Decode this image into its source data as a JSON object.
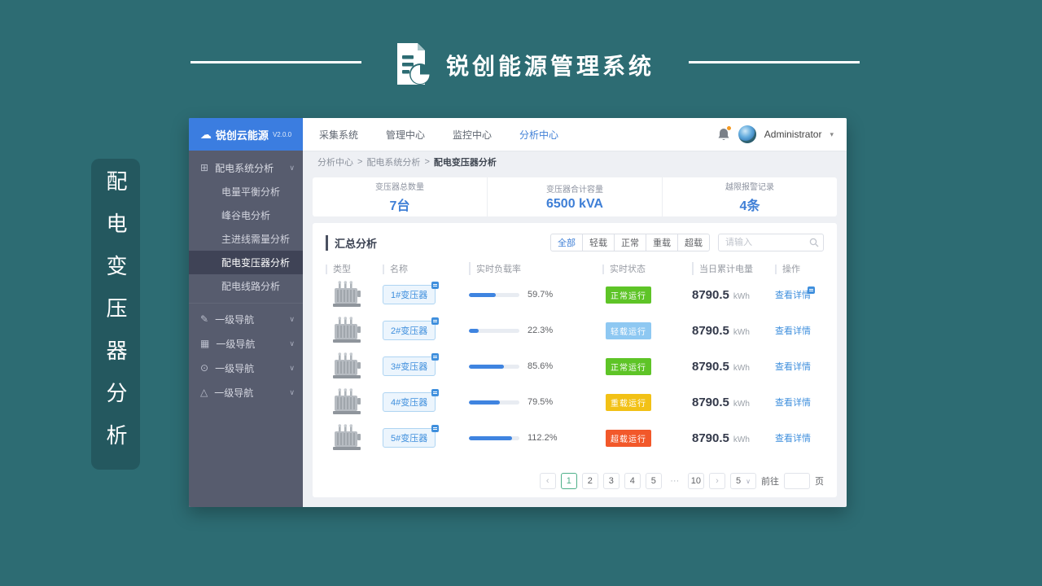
{
  "brand": {
    "title": "锐创能源管理系统"
  },
  "side_card": {
    "text": "配电变压器分析"
  },
  "icons": {
    "cloud": "☁",
    "chevron_down": "∨",
    "caret_down": "▾",
    "prev": "‹",
    "next": "›"
  },
  "colors": {
    "accent_blue": "#3f7fd6",
    "brand_teal": "#2d6c73"
  },
  "app": {
    "sidebar": {
      "logo_name": "锐创云能源",
      "logo_version": "V2.0.0",
      "group": {
        "icon": "⊞",
        "label": "配电系统分析"
      },
      "children": [
        {
          "label": "电量平衡分析"
        },
        {
          "label": "峰谷电分析"
        },
        {
          "label": "主进线需量分析"
        },
        {
          "label": "配电变压器分析"
        },
        {
          "label": "配电线路分析"
        }
      ],
      "collapsed": [
        {
          "icon": "✎",
          "label": "一级导航"
        },
        {
          "icon": "▦",
          "label": "一级导航"
        },
        {
          "icon": "⊙",
          "label": "一级导航"
        },
        {
          "icon": "△",
          "label": "一级导航"
        }
      ]
    },
    "topbar": {
      "nav": [
        {
          "label": "采集系统"
        },
        {
          "label": "管理中心"
        },
        {
          "label": "监控中心"
        },
        {
          "label": "分析中心"
        }
      ],
      "user": {
        "name": "Administrator"
      }
    },
    "breadcrumb": {
      "items": [
        "分析中心",
        "配电系统分析"
      ],
      "current": "配电变压器分析",
      "separator": ">"
    },
    "stats": [
      {
        "label": "变压器总数量",
        "value": "7台"
      },
      {
        "label": "变压器合计容量",
        "value": "6500 kVA"
      },
      {
        "label": "越限报警记录",
        "value": "4条"
      }
    ],
    "panel": {
      "title": "汇总分析",
      "filters": [
        {
          "label": "全部"
        },
        {
          "label": "轻载"
        },
        {
          "label": "正常"
        },
        {
          "label": "重载"
        },
        {
          "label": "超载"
        }
      ],
      "search_placeholder": "请输入",
      "table": {
        "headers": [
          "类型",
          "名称",
          "实时负载率",
          "实时状态",
          "当日累计电量",
          "操作"
        ],
        "unit": "kWh",
        "action_label": "查看详情",
        "rows": [
          {
            "name": "1#变压器",
            "load": "59.7%",
            "bar_width": "53%",
            "status": "正常运行",
            "status_color": "#5ec427",
            "energy": "8790.5"
          },
          {
            "name": "2#变压器",
            "load": "22.3%",
            "bar_width": "20%",
            "status": "轻载运行",
            "status_color": "#8ec8f2",
            "energy": "8790.5"
          },
          {
            "name": "3#变压器",
            "load": "85.6%",
            "bar_width": "70%",
            "status": "正常运行",
            "status_color": "#5ec427",
            "energy": "8790.5"
          },
          {
            "name": "4#变压器",
            "load": "79.5%",
            "bar_width": "62%",
            "status": "重载运行",
            "status_color": "#f2c116",
            "energy": "8790.5"
          },
          {
            "name": "5#变压器",
            "load": "112.2%",
            "bar_width": "86%",
            "status": "超载运行",
            "status_color": "#f2582a",
            "energy": "8790.5"
          }
        ]
      },
      "pagination": {
        "pages": [
          "1",
          "2",
          "3",
          "4",
          "5",
          "···",
          "10"
        ],
        "page_size": "5",
        "goto_label": "前往",
        "page_unit": "页"
      }
    }
  }
}
